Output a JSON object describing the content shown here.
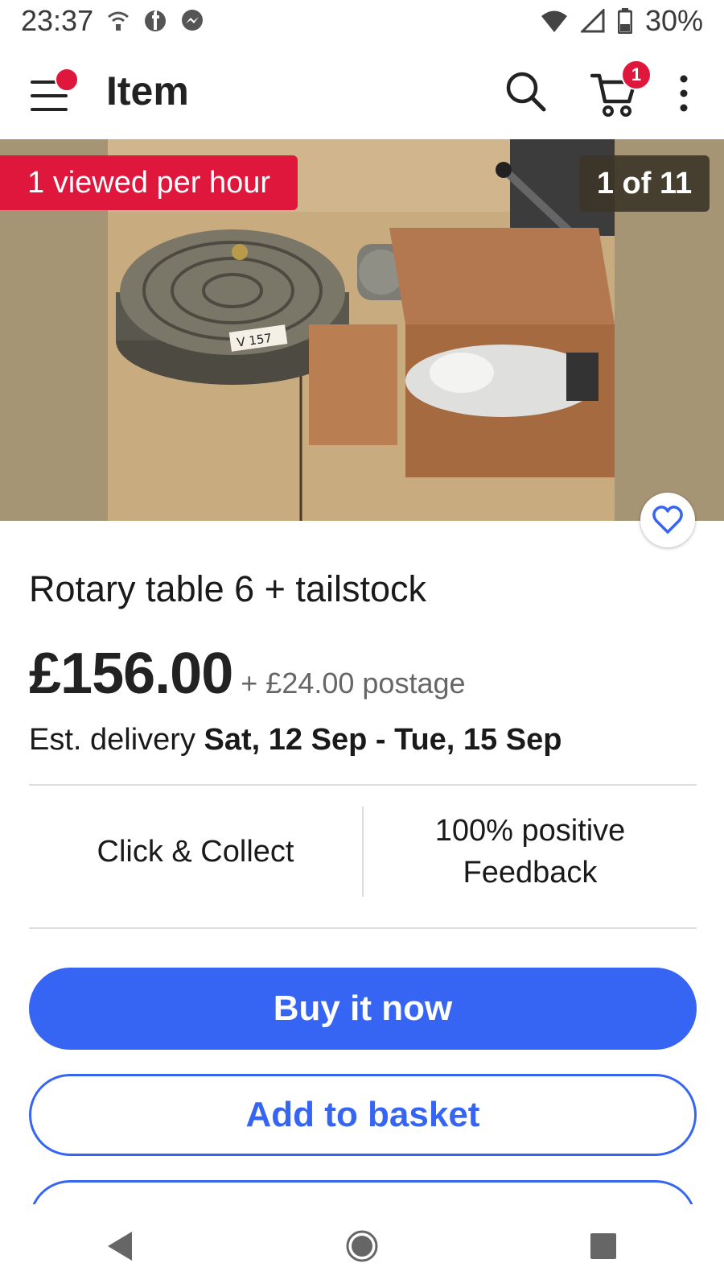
{
  "status_bar": {
    "time": "23:37",
    "battery": "30%",
    "left_icons": [
      "wifi-hotspot-icon",
      "facebook-icon",
      "messenger-icon"
    ],
    "right_icons": [
      "wifi-icon",
      "signal-icon",
      "battery-icon"
    ]
  },
  "app_bar": {
    "title": "Item",
    "cart_count": "1",
    "icons": [
      "menu-icon",
      "search-icon",
      "cart-icon",
      "more-vert-icon"
    ]
  },
  "gallery": {
    "views_badge": "1 viewed per hour",
    "counter": "1 of 11",
    "photo_label": "V 157"
  },
  "item": {
    "title": "Rotary table 6 + tailstock",
    "price": "£156.00",
    "postage": "+ £24.00 postage",
    "delivery_label": "Est. delivery",
    "delivery_dates": "Sat, 12 Sep - Tue, 15 Sep"
  },
  "info": {
    "collect": "Click & Collect",
    "feedback_line1": "100% positive",
    "feedback_line2": "Feedback"
  },
  "actions": {
    "buy_now": "Buy it now",
    "add_to_basket": "Add to basket"
  },
  "colors": {
    "accent_blue": "#3665f3",
    "badge_red": "#e0173c"
  }
}
